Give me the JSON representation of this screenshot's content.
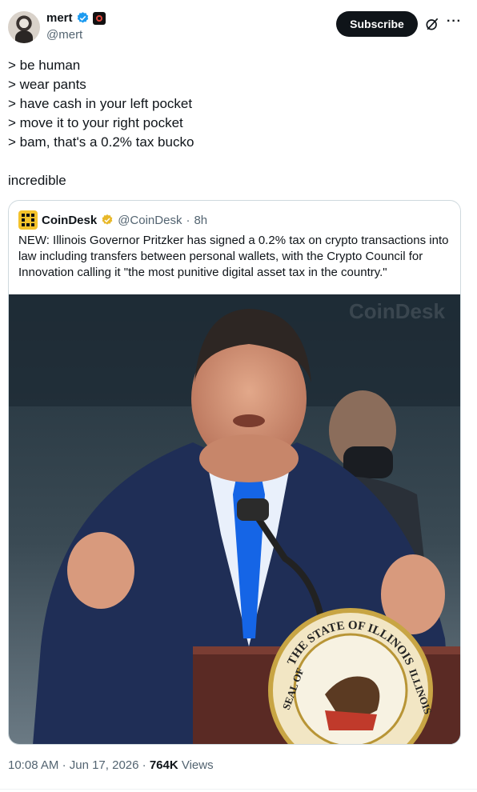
{
  "author": {
    "name": "mert",
    "handle": "@mert",
    "subscribe_label": "Subscribe"
  },
  "tweet": {
    "lines": [
      "> be human",
      "> wear pants",
      "> have cash in your left pocket",
      "> move it to your right pocket",
      "> bam, that's a 0.2% tax bucko"
    ],
    "closing": "incredible"
  },
  "quote": {
    "name": "CoinDesk",
    "handle": "@CoinDesk",
    "time": "8h",
    "text": "NEW: Illinois Governor Pritzker has signed a 0.2% tax on crypto transactions into law including transfers between personal wallets, with the Crypto Council for Innovation calling it \"the most punitive digital asset tax in the country.\"",
    "image": {
      "watermark": "CoinDesk",
      "seal_top": "THE STATE OF ILLINOIS",
      "seal_left": "SEAL OF",
      "seal_right": "ILLINOIS"
    }
  },
  "footer": {
    "time": "10:08 AM",
    "date": "Jun 17, 2026",
    "views_count": "764K",
    "views_label": "Views"
  },
  "colors": {
    "verified_blue": "#1d9bf0",
    "verified_gold": "#e8b829",
    "text": "#0f1419",
    "muted": "#536471"
  },
  "icons": [
    "verified-badge-icon",
    "affiliation-icon",
    "grok-icon",
    "more-icon",
    "coindesk-logo-icon",
    "gold-verified-badge-icon"
  ]
}
